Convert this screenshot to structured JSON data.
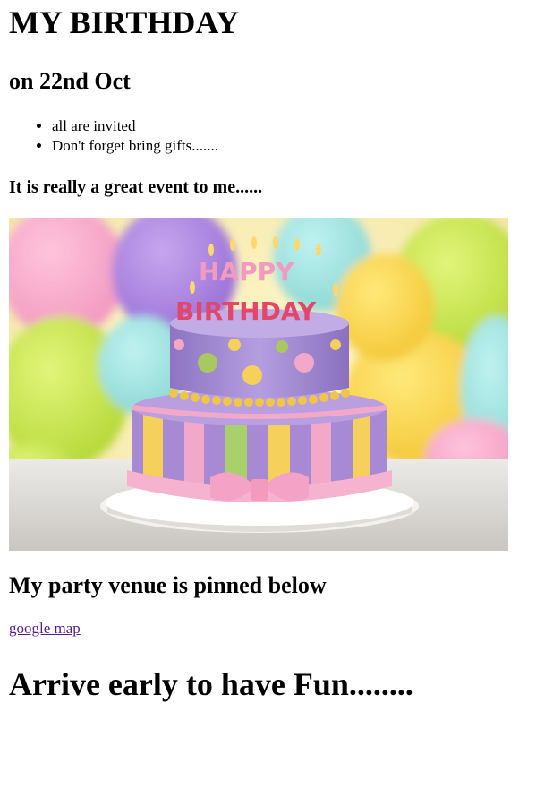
{
  "heading": "MY BIRTHDAY",
  "date_heading": "on 22nd Oct",
  "list": [
    "all are invited",
    "Don't forget bring gifts......."
  ],
  "event_text": "It is really a great event to me......",
  "image": {
    "subject": "birthday-cake-photo",
    "cake_letters_top": "HAPPY",
    "cake_letters_bottom": "BIRTHDAY"
  },
  "venue_heading": "My party venue is pinned below",
  "map_link": "google map",
  "closing_heading": "Arrive early to have Fun........",
  "colors": {
    "link_visited": "#551a8b",
    "cake_purple": "#a98fd4",
    "cake_pink": "#f2a9c9",
    "cake_yellow": "#f5d05a",
    "balloon_green": "#c9e84a"
  }
}
